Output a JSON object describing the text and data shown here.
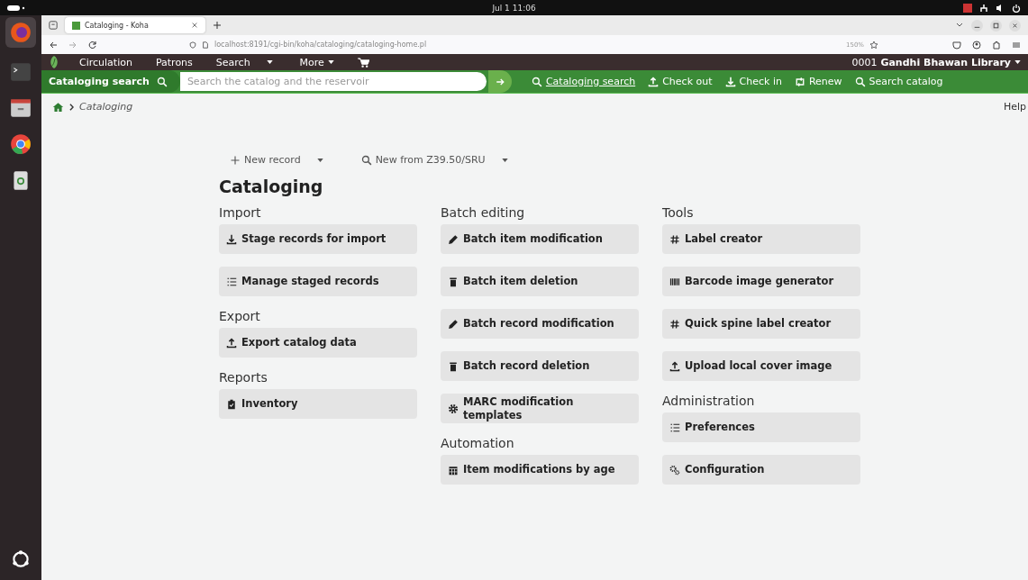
{
  "system_bar": {
    "clock": "Jul 1  11:06"
  },
  "browser": {
    "tab": {
      "title": "Cataloging - Koha",
      "selected": true
    },
    "url": "localhost:8191/cgi-bin/koha/cataloging/cataloging-home.pl",
    "zoom": "150%"
  },
  "nav": {
    "items": [
      {
        "label": "Circulation",
        "kind": "link"
      },
      {
        "label": "Patrons",
        "kind": "link"
      },
      {
        "label": "Search",
        "kind": "link"
      },
      {
        "kind": "caret"
      },
      {
        "label": "More",
        "kind": "menu"
      },
      {
        "kind": "cart"
      }
    ],
    "branch": "0001 **Gandhi Bhawan Library**"
  },
  "search_bar": {
    "label": "Cataloging search",
    "placeholder": "Search the catalog and the reservoir",
    "links": [
      {
        "label": "Cataloging search",
        "kind": "search",
        "selected": true
      },
      {
        "label": "Check out",
        "kind": "upload",
        "selected": false
      },
      {
        "label": "Check in",
        "kind": "download",
        "selected": false
      },
      {
        "label": "Renew",
        "kind": "renew",
        "selected": false
      },
      {
        "label": "Search catalog",
        "kind": "search",
        "selected": false
      }
    ]
  },
  "breadcrumb": {
    "current": "Cataloging"
  },
  "help": "Help",
  "toolbar": [
    {
      "label": "New record",
      "kind": "plus"
    },
    {
      "label": "New from Z39.50/SRU",
      "kind": "search"
    }
  ],
  "title": "Cataloging",
  "columns": [
    [
      {
        "heading": "Import",
        "buttons": [
          {
            "label": "Stage records for import",
            "kind": "download"
          },
          {
            "label": "Manage staged records",
            "kind": "list"
          }
        ]
      },
      {
        "heading": "Export",
        "buttons": [
          {
            "label": "Export catalog data",
            "kind": "upload"
          }
        ]
      },
      {
        "heading": "Reports",
        "buttons": [
          {
            "label": "Inventory",
            "kind": "clipboard"
          }
        ]
      }
    ],
    [
      {
        "heading": "Batch editing",
        "buttons": [
          {
            "label": "Batch item modification",
            "kind": "pencil"
          },
          {
            "label": "Batch item deletion",
            "kind": "trash"
          },
          {
            "label": "Batch record modification",
            "kind": "pencil"
          },
          {
            "label": "Batch record deletion",
            "kind": "trash"
          },
          {
            "label": "MARC modification templates",
            "kind": "gear"
          }
        ]
      },
      {
        "heading": "Automation",
        "buttons": [
          {
            "label": "Item modifications by age",
            "kind": "calendar"
          }
        ]
      }
    ],
    [
      {
        "heading": "Tools",
        "buttons": [
          {
            "label": "Label creator",
            "kind": "hash"
          },
          {
            "label": "Barcode image generator",
            "kind": "barcode"
          },
          {
            "label": "Quick spine label creator",
            "kind": "hash"
          },
          {
            "label": "Upload local cover image",
            "kind": "upload"
          }
        ]
      },
      {
        "heading": "Administration",
        "buttons": [
          {
            "label": "Preferences",
            "kind": "list"
          },
          {
            "label": "Configuration",
            "kind": "cogs"
          }
        ]
      }
    ]
  ]
}
